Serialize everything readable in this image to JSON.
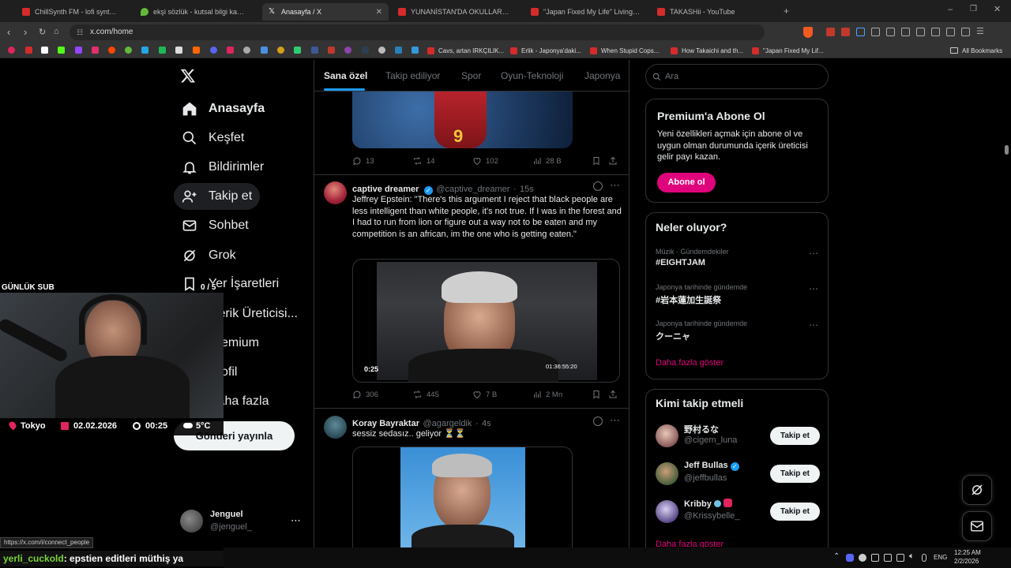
{
  "browser": {
    "tabs": [
      {
        "label": "ChillSynth FM - lofi synthwave ra",
        "color": "#d62b2b"
      },
      {
        "label": "ekşi sözlük - kutsal bilgi kaynağı",
        "color": "#63b93a"
      },
      {
        "label": "Anasayfa / X",
        "color": "#ffffff"
      },
      {
        "label": "YUNANİSTAN'DA OKULLARDA TÜRK",
        "color": "#d62b2b"
      },
      {
        "label": "\"Japan Fixed My Life\" Living in Japan",
        "color": "#d62b2b"
      },
      {
        "label": "TAKASHii - YouTube",
        "color": "#d62b2b"
      }
    ],
    "url": "x.com/home",
    "bookmarks": [
      {
        "label": "Cavs, artan IRKÇILIK...",
        "color": "#d62b2b"
      },
      {
        "label": "Erlik - Japonya'daki...",
        "color": "#d62b2b"
      },
      {
        "label": "When Stupid Cops...",
        "color": "#d62b2b"
      },
      {
        "label": "How Takaichi and th...",
        "color": "#d62b2b"
      },
      {
        "label": "\"Japan Fixed My Lif...",
        "color": "#d62b2b"
      }
    ],
    "all_bookmarks": "All Bookmarks",
    "status_url": "https://x.com/i/connect_people"
  },
  "nav": {
    "items": [
      {
        "label": "Anasayfa",
        "icon": "home-icon"
      },
      {
        "label": "Keşfet",
        "icon": "search-icon"
      },
      {
        "label": "Bildirimler",
        "icon": "bell-icon"
      },
      {
        "label": "Takip et",
        "icon": "add-person-icon"
      },
      {
        "label": "Sohbet",
        "icon": "mail-icon"
      },
      {
        "label": "Grok",
        "icon": "grok-icon"
      },
      {
        "label": "Yer İşaretleri",
        "icon": "bookmark-icon"
      },
      {
        "label": "İçerik Üreticisi...",
        "icon": "creator-icon"
      },
      {
        "label": "Premium",
        "icon": "x-icon"
      },
      {
        "label": "Profil",
        "icon": "person-icon"
      },
      {
        "label": "Daha fazla",
        "icon": "more-icon"
      }
    ],
    "post_button": "Gönderi yayınla",
    "account": {
      "name": "Jenguel",
      "handle": "@jenguel_"
    }
  },
  "feed": {
    "tabs": [
      "Sana özel",
      "Takip ediliyor",
      "Spor",
      "Oyun-Teknoloji",
      "Japonya"
    ],
    "tweets": [
      {
        "counts": {
          "replies": "13",
          "retweets": "14",
          "likes": "102",
          "views": "28 B"
        }
      },
      {
        "name": "captive dreamer",
        "handle": "@captive_dreamer",
        "time": "15s",
        "text": "Jeffrey Epstein: \"There's this argument I reject that black people are less intelligent than white people, it's not true.  If I was in the forest and I had to run from lion or figure out a way not to be eaten and my competition is an african, im the one who is getting eaten.\"",
        "video": {
          "elapsed": "0:25",
          "timecode": "01:36:55:20"
        },
        "counts": {
          "replies": "306",
          "retweets": "445",
          "likes": "7 B",
          "views": "2 Mn"
        }
      },
      {
        "name": "Koray Bayraktar",
        "handle": "@agargeldik",
        "time": "4s",
        "text": "sessiz sedasız.. geliyor ⏳⏳"
      }
    ]
  },
  "sidebar": {
    "search_placeholder": "Ara",
    "premium": {
      "title": "Premium'a Abone Ol",
      "body": "Yeni özellikleri açmak için abone ol ve uygun olman durumunda içerik üreticisi gelir payı kazan.",
      "button": "Abone ol"
    },
    "trends": {
      "title": "Neler oluyor?",
      "items": [
        {
          "category": "Müzik · Gündemdekiler",
          "name": "#EIGHTJAM"
        },
        {
          "category": "Japonya tarihinde gündemde",
          "name": "#岩本蓮加生誕祭"
        },
        {
          "category": "Japonya tarihinde gündemde",
          "name": "クーニャ"
        }
      ],
      "more": "Daha fazla göster"
    },
    "who_to_follow": {
      "title": "Kimi takip etmeli",
      "users": [
        {
          "name": "野村るな",
          "handle": "@cigem_luna",
          "verified": false
        },
        {
          "name": "Jeff Bullas",
          "handle": "@jeffbullas",
          "verified": true
        },
        {
          "name": "Kribby",
          "handle": "@Krissybelle_",
          "verified": false
        }
      ],
      "follow_label": "Takip et",
      "more": "Daha fazla göster"
    }
  },
  "overlay": {
    "sub_label": "GÜNLÜK SUB",
    "sub_count": "0 / 5",
    "city": "Tokyo",
    "date": "02.02.2026",
    "time": "00:25",
    "temp": "5°C",
    "chat_user": "yerli_cuckold",
    "chat_msg": ": epstien editleri müthiş ya"
  },
  "taskbar": {
    "lang": "ENG",
    "time": "12:25 AM",
    "date": "2/2/2026"
  }
}
